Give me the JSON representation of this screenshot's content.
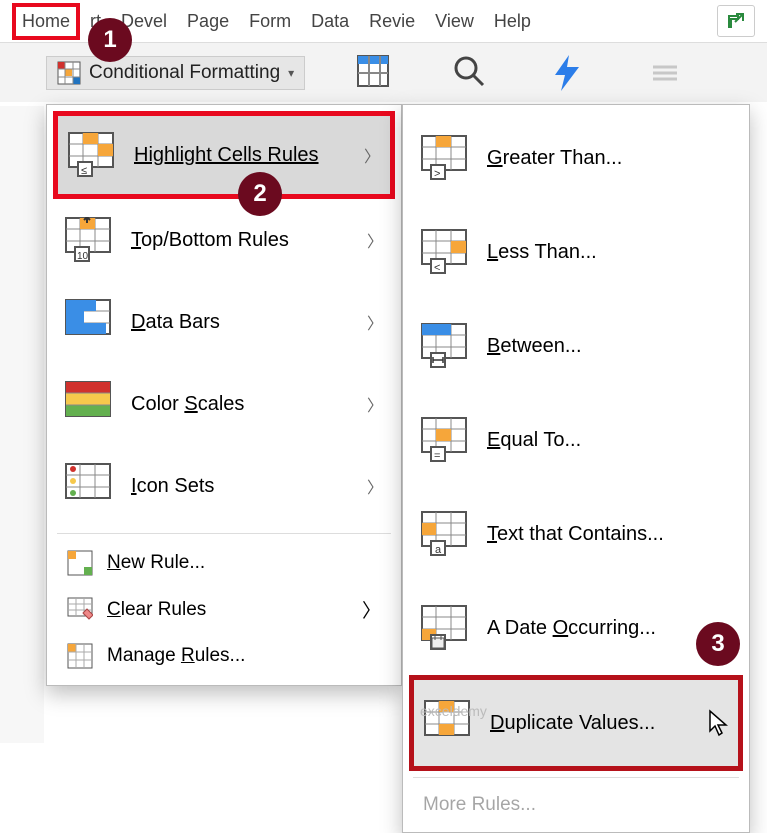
{
  "tabs": {
    "home": "Home",
    "insert": "rt",
    "devel": "Devel",
    "page": "Page",
    "form": "Form",
    "data": "Data",
    "review": "Revie",
    "view": "View",
    "help": "Help"
  },
  "toolbar": {
    "cf_label": "Conditional Formatting"
  },
  "menu": {
    "highlight": "Highlight Cells Rules",
    "topbottom": "Top/Bottom Rules",
    "databars": "Data Bars",
    "colorscales": "Color Scales",
    "iconsets": "Icon Sets",
    "newrule": "New Rule...",
    "clearrules": "Clear Rules",
    "managerules": "Manage Rules..."
  },
  "submenu": {
    "greater": "Greater Than...",
    "less": "Less Than...",
    "between": "Between...",
    "equal": "Equal To...",
    "textcontains": "Text that Contains...",
    "dateoccurring": "A Date Occurring...",
    "duplicate": "Duplicate Values...",
    "morerules": "More Rules..."
  },
  "callouts": {
    "one": "1",
    "two": "2",
    "three": "3"
  },
  "watermark": "exceldemy"
}
